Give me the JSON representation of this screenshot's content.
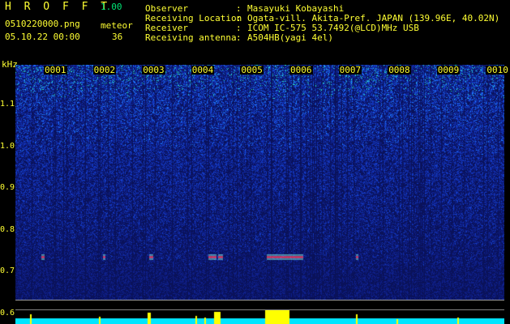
{
  "header": {
    "app_title": "H R O F F T",
    "version": "1.00",
    "filename": "0510220000.png",
    "datetime": "05.10.22 00:00",
    "meteor_label": "meteor",
    "meteor_count": "36"
  },
  "info": [
    {
      "key": "Observer",
      "value": "Masayuki Kobayashi"
    },
    {
      "key": "Receiving Location",
      "value": "Ogata-vill. Akita-Pref. JAPAN (139.96E, 40.02N)"
    },
    {
      "key": "Receiver",
      "value": "ICOM IC-575 53.7492(@LCD)MHz USB"
    },
    {
      "key": "Receiving antenna",
      "value": "A504HB(yagi 4el)"
    }
  ],
  "separator": ":",
  "spectrogram": {
    "y_unit": "kHz",
    "y_ticks": [
      "1.1",
      "1.0",
      "0.9",
      "0.8",
      "0.7",
      "0.6"
    ],
    "y_values": [
      1.1,
      1.0,
      0.9,
      0.8,
      0.7,
      0.6
    ],
    "y_range": [
      0.575,
      1.195
    ],
    "x_ticks": [
      "0001",
      "0002",
      "0003",
      "0004",
      "0005",
      "0006",
      "0007",
      "0008",
      "0009",
      "0010"
    ],
    "colors": {
      "background": "#000000",
      "text": "#ffff33",
      "spectrum_low": "#0c1568",
      "spectrum_mid": "#2a6cff",
      "spectrum_high": "#33ffcc",
      "meteor_echo": "#ff4466",
      "level_fill": "#00e5ff",
      "level_peak": "#ffff00"
    }
  }
}
